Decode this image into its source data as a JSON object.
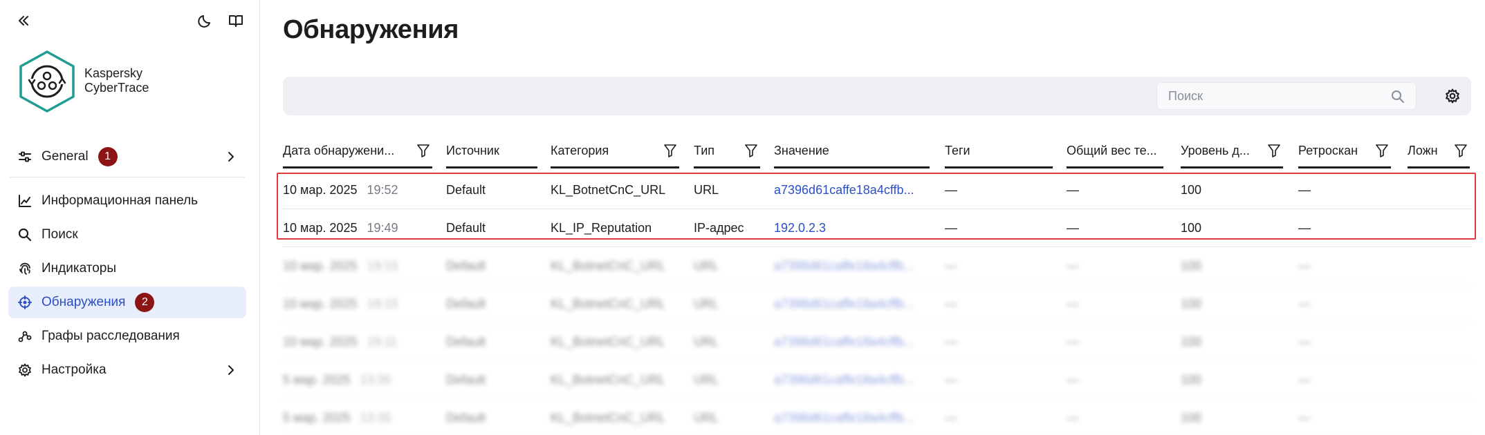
{
  "app": {
    "name_line1": "Kaspersky",
    "name_line2": "CyberTrace"
  },
  "sidebar": {
    "items": [
      {
        "label": "General",
        "badge": "1",
        "has_chevron": true
      },
      {
        "label": "Информационная панель"
      },
      {
        "label": "Поиск"
      },
      {
        "label": "Индикаторы"
      },
      {
        "label": "Обнаружения",
        "badge": "2",
        "active": true
      },
      {
        "label": "Графы расследования"
      },
      {
        "label": "Настройка",
        "has_chevron": true
      }
    ]
  },
  "page": {
    "title": "Обнаружения"
  },
  "search": {
    "placeholder": "Поиск"
  },
  "table": {
    "columns": [
      "Дата обнаружени...",
      "Источник",
      "Категория",
      "Тип",
      "Значение",
      "Теги",
      "Общий вес те...",
      "Уровень д...",
      "Ретроскан",
      "Ложн"
    ],
    "rows": [
      {
        "date": "10 мар. 2025",
        "time": "19:52",
        "source": "Default",
        "category": "KL_BotnetCnC_URL",
        "type": "URL",
        "value": "a7396d61caffe18a4cffb...",
        "tags": "—",
        "weight": "—",
        "level": "100",
        "retro": "—"
      },
      {
        "date": "10 мар. 2025",
        "time": "19:49",
        "source": "Default",
        "category": "KL_IP_Reputation",
        "type": "IP-адрес",
        "value": "192.0.2.3",
        "tags": "—",
        "weight": "—",
        "level": "100",
        "retro": "—"
      },
      {
        "date": "10 мар. 2025",
        "time": "19:15",
        "source": "Default",
        "category": "KL_BotnetCnC_URL",
        "type": "URL",
        "value": "a7396d61caffe18a4cffb...",
        "tags": "—",
        "weight": "—",
        "level": "100",
        "retro": "—"
      },
      {
        "date": "10 мар. 2025",
        "time": "19:15",
        "source": "Default",
        "category": "KL_BotnetCnC_URL",
        "type": "URL",
        "value": "a7396d61caffe18a4cffb...",
        "tags": "—",
        "weight": "—",
        "level": "100",
        "retro": "—"
      },
      {
        "date": "10 мар. 2025",
        "time": "19:11",
        "source": "Default",
        "category": "KL_BotnetCnC_URL",
        "type": "URL",
        "value": "a7396d61caffe18a4cffb...",
        "tags": "—",
        "weight": "—",
        "level": "100",
        "retro": "—"
      },
      {
        "date": "5 мар. 2025",
        "time": "13:35",
        "source": "Default",
        "category": "KL_BotnetCnC_URL",
        "type": "URL",
        "value": "a7396d61caffe18a4cffb...",
        "tags": "—",
        "weight": "—",
        "level": "100",
        "retro": "—"
      },
      {
        "date": "5 мар. 2025",
        "time": "13:35",
        "source": "Default",
        "category": "KL_BotnetCnC_URL",
        "type": "URL",
        "value": "a7396d61caffe18a4cffb...",
        "tags": "—",
        "weight": "—",
        "level": "100",
        "retro": "—"
      }
    ]
  },
  "colors": {
    "accent": "#2b4fc4",
    "badge": "#8c1414",
    "highlight": "#e0383e",
    "toolbar_bg": "#eef0f3",
    "active_bg": "#e8eefb"
  },
  "icons": [
    "collapse-icon",
    "moon-icon",
    "book-icon",
    "logo-icon",
    "sliders-icon",
    "chart-icon",
    "search-icon",
    "fingerprint-icon",
    "crosshair-icon",
    "graph-icon",
    "gear-icon",
    "filter-icon",
    "chevron-right-icon"
  ]
}
